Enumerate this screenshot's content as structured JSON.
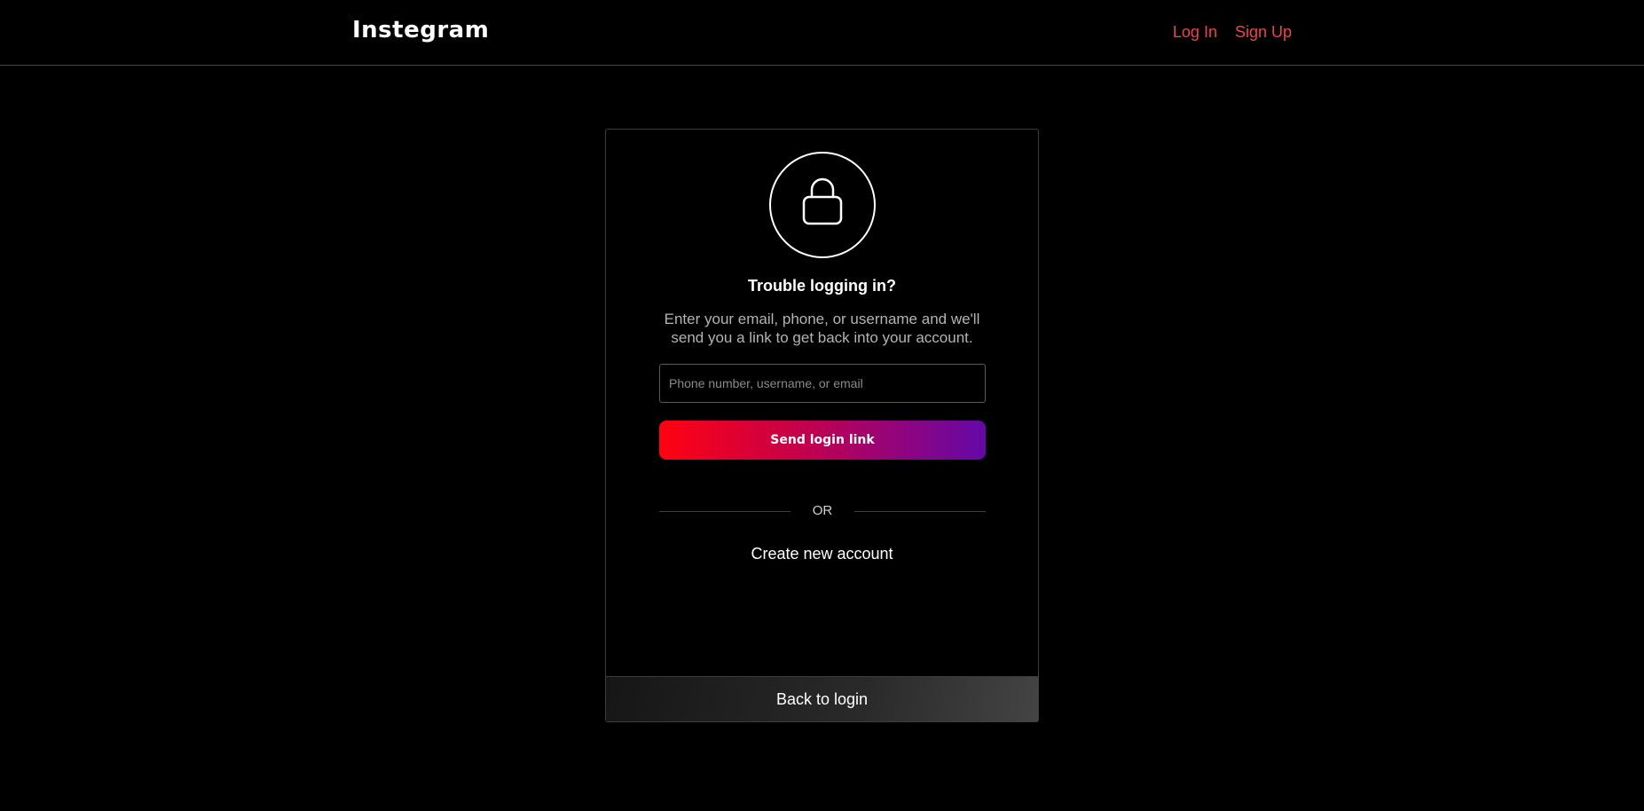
{
  "header": {
    "logo": "Instegram",
    "nav": {
      "login_label": "Log In",
      "signup_label": "Sign Up"
    }
  },
  "card": {
    "icon": "lock-icon",
    "title": "Trouble logging in?",
    "description": "Enter your email, phone, or username and we'll send you a link to get back into your account.",
    "input": {
      "value": "",
      "placeholder": "Phone number, username, or email"
    },
    "send_button_label": "Send login link",
    "divider_label": "OR",
    "create_account_label": "Create new account",
    "back_to_login_label": "Back to login"
  },
  "colors": {
    "background": "#000000",
    "nav_link": "#f0424e",
    "button_gradient_start": "#ff0210",
    "button_gradient_end": "#6408a8"
  }
}
